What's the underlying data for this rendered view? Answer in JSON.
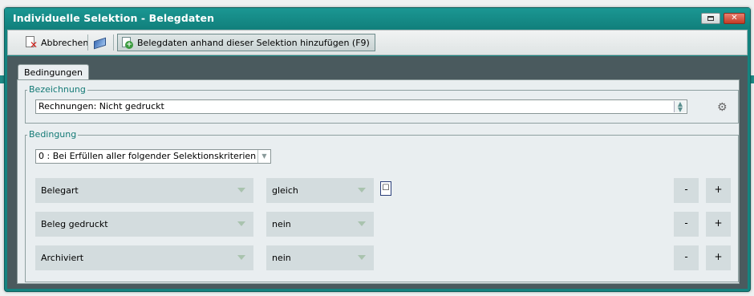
{
  "window": {
    "title": "Individuelle Selektion - Belegdaten"
  },
  "toolbar": {
    "cancel_label": "Abbrechen",
    "add_label": "Belegdaten anhand dieser Selektion hinzufügen (F9)"
  },
  "tabs": [
    {
      "label": "Bedingungen",
      "active": true
    }
  ],
  "bezeichnung": {
    "group_label": "Bezeichnung",
    "value": "Rechnungen: Nicht gedruckt"
  },
  "bedingung": {
    "group_label": "Bedingung",
    "mode": "0 : Bei Erfüllen aller folgender Selektionskriterien",
    "rows": [
      {
        "field": "Belegart",
        "operator": "gleich",
        "minus": "-",
        "plus": "+"
      },
      {
        "field": "Beleg gedruckt",
        "operator": "nein",
        "minus": "-",
        "plus": "+"
      },
      {
        "field": "Archiviert",
        "operator": "nein",
        "minus": "-",
        "plus": "+"
      }
    ]
  },
  "colors": {
    "titlebar": "#158480",
    "panel": "#e9eef0",
    "content_bg": "#4a5a5e",
    "field_bg": "#d3dcde",
    "group_label": "#147a76"
  }
}
